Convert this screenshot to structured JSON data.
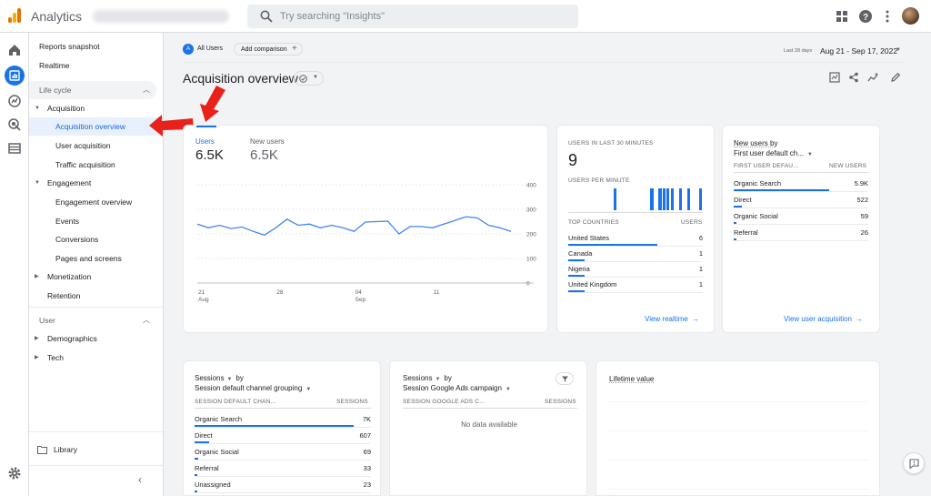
{
  "topbar": {
    "app_title": "Analytics",
    "search_placeholder": "Try searching \"Insights\""
  },
  "nav": {
    "reports_snapshot": "Reports snapshot",
    "realtime": "Realtime",
    "lifecycle_section": "Life cycle",
    "acquisition": "Acquisition",
    "acquisition_overview": "Acquisition overview",
    "user_acquisition": "User acquisition",
    "traffic_acquisition": "Traffic acquisition",
    "engagement": "Engagement",
    "engagement_overview": "Engagement overview",
    "events": "Events",
    "conversions": "Conversions",
    "pages_and_screens": "Pages and screens",
    "monetization": "Monetization",
    "retention": "Retention",
    "user_section": "User",
    "demographics": "Demographics",
    "tech": "Tech",
    "library": "Library"
  },
  "header": {
    "all_users": "All Users",
    "all_users_badge": "A",
    "add_comparison": "Add comparison",
    "date_prefix": "Last 28 days",
    "date_range": "Aug 21 - Sep 17, 2022",
    "page_title": "Acquisition overview"
  },
  "users_card": {
    "tab_users": "Users",
    "tab_users_value": "6.5K",
    "tab_new_users": "New users",
    "tab_new_users_value": "6.5K"
  },
  "chart_data": {
    "type": "line",
    "x_tick_labels": [
      "21\nAug",
      "28",
      "04\nSep",
      "11"
    ],
    "x": [
      1,
      2,
      3,
      4,
      5,
      6,
      7,
      8,
      9,
      10,
      11,
      12,
      13,
      14,
      15,
      16,
      17,
      18,
      19,
      20,
      21,
      22,
      23,
      24,
      25,
      26,
      27,
      28
    ],
    "series": [
      {
        "values": [
          240,
          225,
          235,
          222,
          228,
          210,
          195,
          225,
          260,
          235,
          240,
          225,
          235,
          225,
          210,
          248,
          250,
          252,
          200,
          230,
          230,
          225,
          240,
          255,
          270,
          265,
          235,
          225,
          210
        ]
      }
    ],
    "ylim": [
      0,
      400
    ],
    "y_ticks": [
      0,
      100,
      200,
      300,
      400
    ],
    "color": "#4285f4"
  },
  "realtime_card": {
    "title": "USERS IN LAST 30 MINUTES",
    "value": "9",
    "per_minute_label": "USERS PER MINUTE",
    "per_minute_bars": [
      0,
      0,
      0,
      0,
      0,
      0,
      0,
      0,
      0,
      0,
      0,
      1,
      0,
      0,
      0,
      0,
      0,
      0,
      0,
      0,
      1,
      0,
      1,
      1,
      1,
      1,
      0,
      1,
      0,
      1,
      0,
      0,
      1
    ],
    "countries_header": "TOP COUNTRIES",
    "users_header": "USERS",
    "rows": [
      {
        "name": "United States",
        "value": "6",
        "pct": 1.0
      },
      {
        "name": "Canada",
        "value": "1",
        "pct": 0.18
      },
      {
        "name": "Nigeria",
        "value": "1",
        "pct": 0.18
      },
      {
        "name": "United Kingdom",
        "value": "1",
        "pct": 0.18
      }
    ],
    "link": "View realtime"
  },
  "new_users_card": {
    "title": "New users by",
    "subtitle": "First user default ch...",
    "col1": "FIRST USER DEFAU...",
    "col2": "NEW USERS",
    "rows": [
      {
        "name": "Organic Search",
        "value": "5.9K",
        "pct": 1.0
      },
      {
        "name": "Direct",
        "value": "522",
        "pct": 0.09
      },
      {
        "name": "Organic Social",
        "value": "59",
        "pct": 0.02
      },
      {
        "name": "Referral",
        "value": "26",
        "pct": 0.01
      }
    ],
    "link": "View user acquisition"
  },
  "sessions_card": {
    "title": "Sessions",
    "by": "by",
    "subtitle": "Session default channel grouping",
    "col1": "SESSION DEFAULT CHAN...",
    "col2": "SESSIONS",
    "rows": [
      {
        "name": "Organic Search",
        "value": "7K",
        "pct": 1.0
      },
      {
        "name": "Direct",
        "value": "607",
        "pct": 0.09
      },
      {
        "name": "Organic Social",
        "value": "69",
        "pct": 0.02
      },
      {
        "name": "Referral",
        "value": "33",
        "pct": 0.01
      },
      {
        "name": "Unassigned",
        "value": "23",
        "pct": 0.01
      }
    ]
  },
  "ads_card": {
    "title": "Sessions",
    "by": "by",
    "subtitle": "Session Google Ads campaign",
    "col1": "SESSION GOOGLE ADS C...",
    "col2": "SESSIONS",
    "empty": "No data available"
  },
  "ltv_card": {
    "title": "Lifetime value"
  },
  "colors": {
    "accent": "#1a73e8",
    "annotation": "#e8221b"
  }
}
